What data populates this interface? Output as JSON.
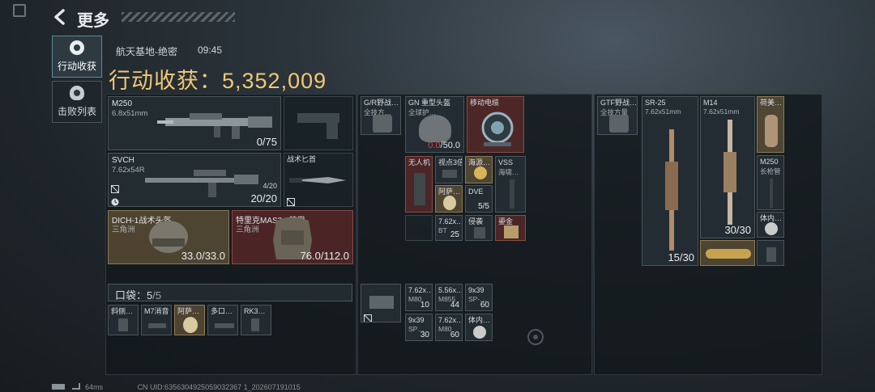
{
  "header": {
    "title": "更多",
    "map_name": "航天基地-绝密",
    "time": "09:45",
    "harvest_label": "行动收获：",
    "harvest_value": "5,352,009"
  },
  "side_tabs": [
    {
      "label": "行动收获",
      "icon": "coin-icon",
      "active": true
    },
    {
      "label": "击败列表",
      "icon": "skull-icon",
      "active": false
    }
  ],
  "loadout": {
    "primary": {
      "name": "M250",
      "caliber": "6.8x51mm",
      "ammo": "0/75"
    },
    "secondary": {
      "name": "SVCH",
      "caliber": "7.62x54R",
      "mag": "4/20",
      "ammo": "20/20"
    },
    "melee": {
      "name": "战术匕首"
    },
    "helmet": {
      "name": "DICH-1战术头盔",
      "origin": "三角洲",
      "durability": "33.0/33.0"
    },
    "armor": {
      "name": "特里克MAS2.0装甲",
      "origin": "三角洲",
      "durability": "76.0/112.0"
    }
  },
  "pocket": {
    "label": "口袋：",
    "used": "5",
    "total": "/5",
    "items": [
      "斜侧…",
      "M7消音",
      "阿萨…",
      "多口…",
      "RK3…"
    ]
  },
  "chest_rig": {
    "name_line1": "G/R野战…",
    "name_line2": "全技方…"
  },
  "backpack_center": {
    "helmet": {
      "name": "GN 重型头盔",
      "sub": "全球护…",
      "dur_current": "0.0",
      "dur_total": "/50.0"
    },
    "cable": {
      "name": "移动电缆"
    },
    "drone": {
      "name": "无人机"
    },
    "scope": {
      "name": "视点3倍"
    },
    "gold": {
      "name": "海源…"
    },
    "vss": {
      "name": "VSS",
      "sub": "海啸…"
    },
    "amulet": {
      "name": "阿萨…"
    },
    "dve": {
      "name": "DVE",
      "count": "5/5"
    },
    "ammo1": {
      "name": "7.62x…",
      "sub": "BT",
      "count": "25"
    },
    "tool": {
      "name": "侵袭"
    },
    "card": {
      "name": "鎏金"
    }
  },
  "pouch": {
    "items": [
      {
        "name": "7.62x…",
        "sub": "M80",
        "count": "10"
      },
      {
        "name": "5.56x…",
        "sub": "M855",
        "count": "44"
      },
      {
        "name": "9x39",
        "sub": "SP-…",
        "count": "60"
      },
      {
        "name": "9x39",
        "sub": "SP…",
        "count": "30"
      },
      {
        "name": "7.62x…",
        "sub": "M80",
        "count": "60"
      },
      {
        "name": "体内…",
        "sub": "",
        "count": ""
      }
    ]
  },
  "right_panel": {
    "rig": {
      "name_line1": "GTF野战…",
      "name_line2": "全技方量"
    },
    "sr25": {
      "name": "SR-25",
      "caliber": "7.62x51mm",
      "ammo": "15/30"
    },
    "m14": {
      "name": "M14",
      "caliber": "7.62x51mm",
      "ammo": "30/30"
    },
    "figurine": {
      "name": "荷美…"
    },
    "barrel": {
      "name": "M250",
      "sub": "长枪管"
    },
    "body": {
      "name": "体内…"
    }
  },
  "footer": {
    "ping": "64ms",
    "uid": "CN UID:6356304925059032367 1_202607191015"
  }
}
